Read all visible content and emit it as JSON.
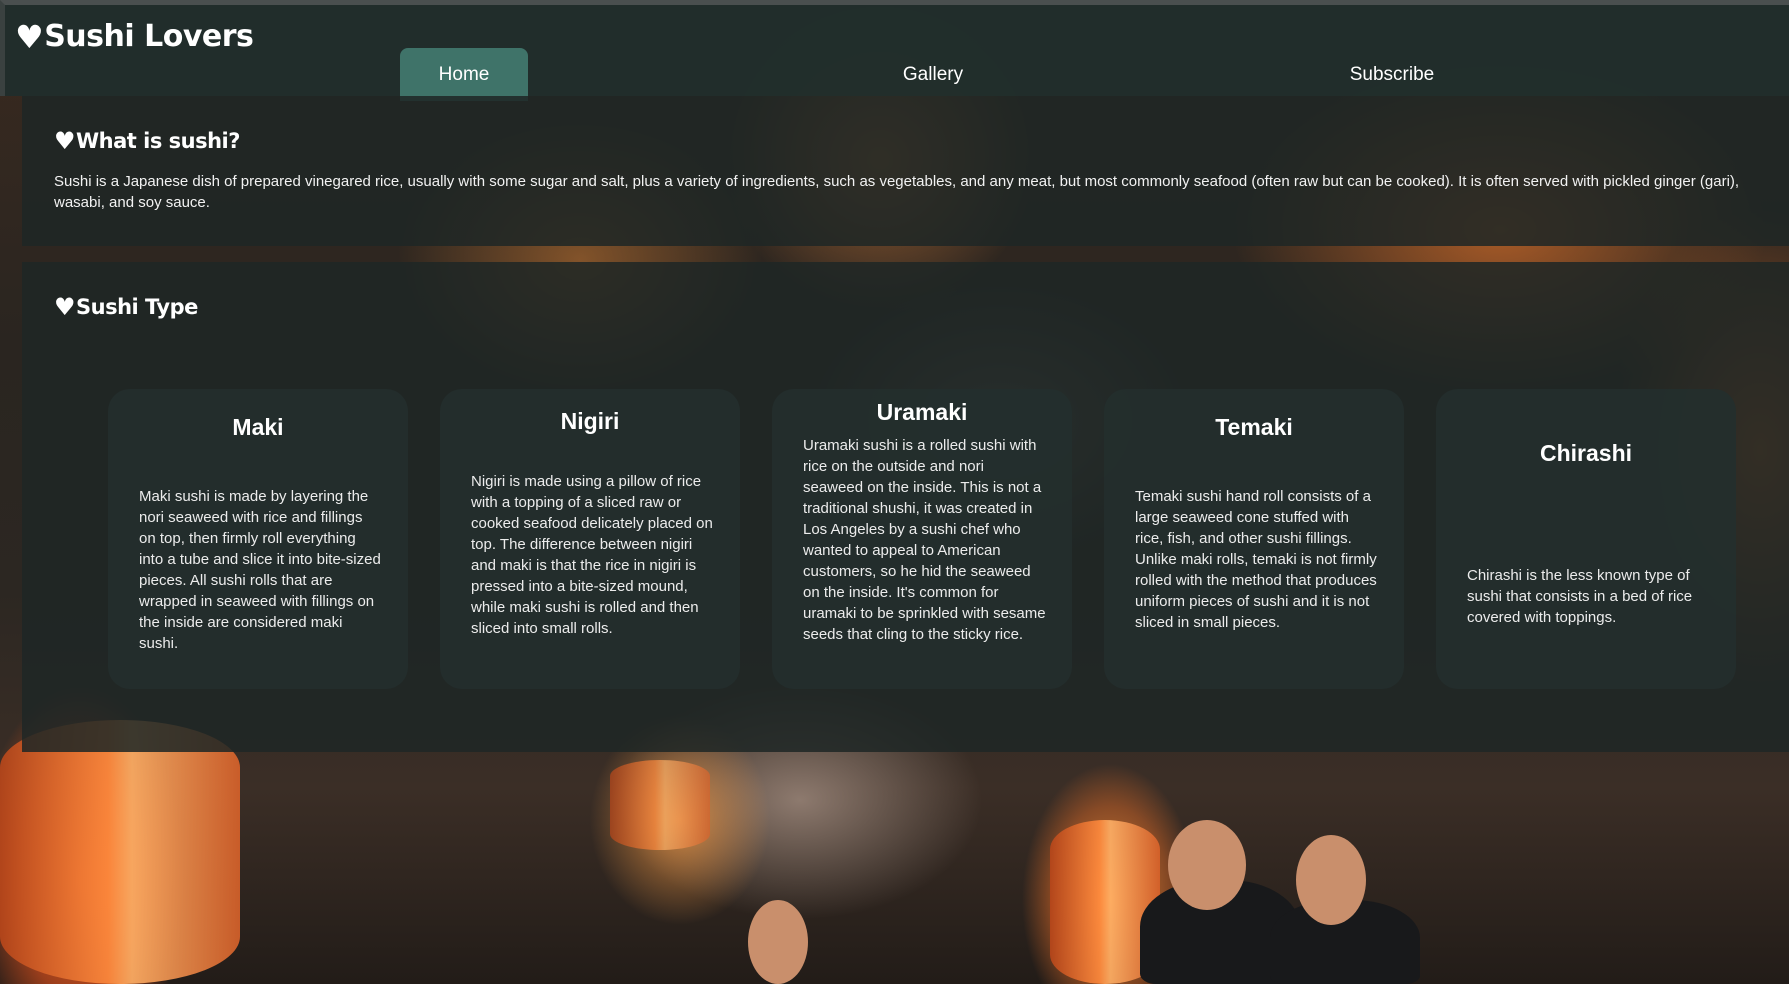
{
  "site": {
    "logo_text": "Sushi Lovers",
    "logo_icon": "heart-icon"
  },
  "nav": {
    "items": [
      {
        "label": "Home",
        "active": true
      },
      {
        "label": "Gallery",
        "active": false
      },
      {
        "label": "Subscribe",
        "active": false
      }
    ]
  },
  "intro": {
    "title": "What is sushi?",
    "text": "Sushi is a Japanese dish of prepared vinegared rice, usually with some sugar and salt, plus a variety of ingredients, such as vegetables, and any meat, but most commonly seafood (often raw but can be cooked). It is often served with pickled ginger (gari), wasabi, and soy sauce."
  },
  "types": {
    "title": "Sushi Type",
    "cards": [
      {
        "title": "Maki",
        "description": "Maki sushi is made by layering the nori seaweed with rice and fillings on top, then firmly roll everything into a tube and slice it into bite-sized pieces. All sushi rolls that are wrapped in seaweed with fillings on the inside are considered maki sushi."
      },
      {
        "title": "Nigiri",
        "description": "Nigiri is made using a pillow of rice with a topping of a sliced raw or cooked seafood delicately placed on top. The difference between nigiri and maki is that the rice in nigiri is pressed into a bite-sized mound, while maki sushi is rolled and then sliced into small rolls."
      },
      {
        "title": "Uramaki",
        "description": "Uramaki sushi is a rolled sushi with rice on the outside and nori seaweed on the inside. This is not a traditional shushi, it was created in Los Angeles by a sushi chef who wanted to appeal to American customers, so he hid the seaweed on the inside. It's common for uramaki to be sprinkled with sesame seeds that cling to the sticky rice."
      },
      {
        "title": "Temaki",
        "description": "Temaki sushi hand roll consists of a large seaweed cone stuffed with rice, fish, and other sushi fillings. Unlike maki rolls, temaki is not firmly rolled with the method that produces uniform pieces of sushi and it is not sliced in small pieces."
      },
      {
        "title": "Chirashi",
        "description": "Chirashi is the less known type of sushi that consists in a bed of rice covered with toppings."
      }
    ]
  },
  "colors": {
    "header_bg": "#212e2c",
    "active_tab": "#3f7369",
    "panel_bg": "#1e2625",
    "card_bg": "#242e2d",
    "text": "#ffffff"
  }
}
